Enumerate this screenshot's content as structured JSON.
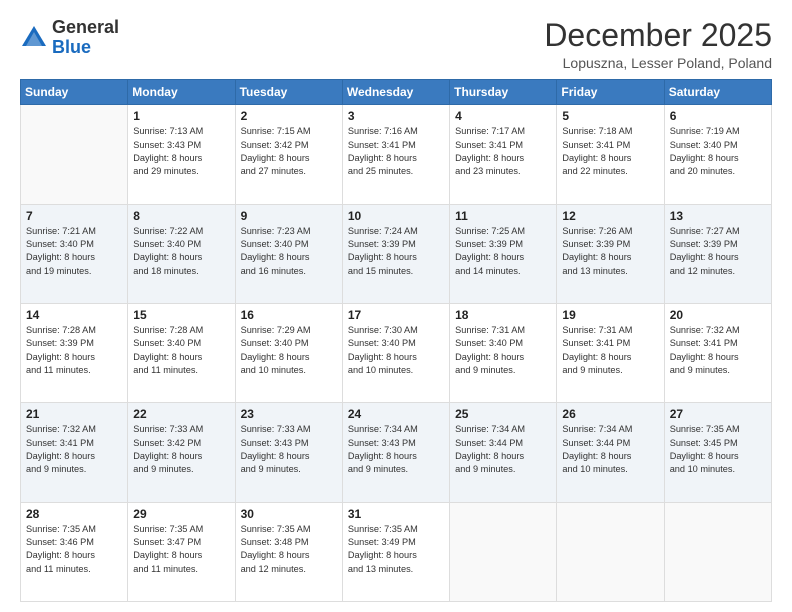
{
  "header": {
    "logo_general": "General",
    "logo_blue": "Blue",
    "month_title": "December 2025",
    "location": "Lopuszna, Lesser Poland, Poland"
  },
  "days_of_week": [
    "Sunday",
    "Monday",
    "Tuesday",
    "Wednesday",
    "Thursday",
    "Friday",
    "Saturday"
  ],
  "weeks": [
    [
      {
        "day": "",
        "info": ""
      },
      {
        "day": "1",
        "info": "Sunrise: 7:13 AM\nSunset: 3:43 PM\nDaylight: 8 hours\nand 29 minutes."
      },
      {
        "day": "2",
        "info": "Sunrise: 7:15 AM\nSunset: 3:42 PM\nDaylight: 8 hours\nand 27 minutes."
      },
      {
        "day": "3",
        "info": "Sunrise: 7:16 AM\nSunset: 3:41 PM\nDaylight: 8 hours\nand 25 minutes."
      },
      {
        "day": "4",
        "info": "Sunrise: 7:17 AM\nSunset: 3:41 PM\nDaylight: 8 hours\nand 23 minutes."
      },
      {
        "day": "5",
        "info": "Sunrise: 7:18 AM\nSunset: 3:41 PM\nDaylight: 8 hours\nand 22 minutes."
      },
      {
        "day": "6",
        "info": "Sunrise: 7:19 AM\nSunset: 3:40 PM\nDaylight: 8 hours\nand 20 minutes."
      }
    ],
    [
      {
        "day": "7",
        "info": "Sunrise: 7:21 AM\nSunset: 3:40 PM\nDaylight: 8 hours\nand 19 minutes."
      },
      {
        "day": "8",
        "info": "Sunrise: 7:22 AM\nSunset: 3:40 PM\nDaylight: 8 hours\nand 18 minutes."
      },
      {
        "day": "9",
        "info": "Sunrise: 7:23 AM\nSunset: 3:40 PM\nDaylight: 8 hours\nand 16 minutes."
      },
      {
        "day": "10",
        "info": "Sunrise: 7:24 AM\nSunset: 3:39 PM\nDaylight: 8 hours\nand 15 minutes."
      },
      {
        "day": "11",
        "info": "Sunrise: 7:25 AM\nSunset: 3:39 PM\nDaylight: 8 hours\nand 14 minutes."
      },
      {
        "day": "12",
        "info": "Sunrise: 7:26 AM\nSunset: 3:39 PM\nDaylight: 8 hours\nand 13 minutes."
      },
      {
        "day": "13",
        "info": "Sunrise: 7:27 AM\nSunset: 3:39 PM\nDaylight: 8 hours\nand 12 minutes."
      }
    ],
    [
      {
        "day": "14",
        "info": "Sunrise: 7:28 AM\nSunset: 3:39 PM\nDaylight: 8 hours\nand 11 minutes."
      },
      {
        "day": "15",
        "info": "Sunrise: 7:28 AM\nSunset: 3:40 PM\nDaylight: 8 hours\nand 11 minutes."
      },
      {
        "day": "16",
        "info": "Sunrise: 7:29 AM\nSunset: 3:40 PM\nDaylight: 8 hours\nand 10 minutes."
      },
      {
        "day": "17",
        "info": "Sunrise: 7:30 AM\nSunset: 3:40 PM\nDaylight: 8 hours\nand 10 minutes."
      },
      {
        "day": "18",
        "info": "Sunrise: 7:31 AM\nSunset: 3:40 PM\nDaylight: 8 hours\nand 9 minutes."
      },
      {
        "day": "19",
        "info": "Sunrise: 7:31 AM\nSunset: 3:41 PM\nDaylight: 8 hours\nand 9 minutes."
      },
      {
        "day": "20",
        "info": "Sunrise: 7:32 AM\nSunset: 3:41 PM\nDaylight: 8 hours\nand 9 minutes."
      }
    ],
    [
      {
        "day": "21",
        "info": "Sunrise: 7:32 AM\nSunset: 3:41 PM\nDaylight: 8 hours\nand 9 minutes."
      },
      {
        "day": "22",
        "info": "Sunrise: 7:33 AM\nSunset: 3:42 PM\nDaylight: 8 hours\nand 9 minutes."
      },
      {
        "day": "23",
        "info": "Sunrise: 7:33 AM\nSunset: 3:43 PM\nDaylight: 8 hours\nand 9 minutes."
      },
      {
        "day": "24",
        "info": "Sunrise: 7:34 AM\nSunset: 3:43 PM\nDaylight: 8 hours\nand 9 minutes."
      },
      {
        "day": "25",
        "info": "Sunrise: 7:34 AM\nSunset: 3:44 PM\nDaylight: 8 hours\nand 9 minutes."
      },
      {
        "day": "26",
        "info": "Sunrise: 7:34 AM\nSunset: 3:44 PM\nDaylight: 8 hours\nand 10 minutes."
      },
      {
        "day": "27",
        "info": "Sunrise: 7:35 AM\nSunset: 3:45 PM\nDaylight: 8 hours\nand 10 minutes."
      }
    ],
    [
      {
        "day": "28",
        "info": "Sunrise: 7:35 AM\nSunset: 3:46 PM\nDaylight: 8 hours\nand 11 minutes."
      },
      {
        "day": "29",
        "info": "Sunrise: 7:35 AM\nSunset: 3:47 PM\nDaylight: 8 hours\nand 11 minutes."
      },
      {
        "day": "30",
        "info": "Sunrise: 7:35 AM\nSunset: 3:48 PM\nDaylight: 8 hours\nand 12 minutes."
      },
      {
        "day": "31",
        "info": "Sunrise: 7:35 AM\nSunset: 3:49 PM\nDaylight: 8 hours\nand 13 minutes."
      },
      {
        "day": "",
        "info": ""
      },
      {
        "day": "",
        "info": ""
      },
      {
        "day": "",
        "info": ""
      }
    ]
  ]
}
